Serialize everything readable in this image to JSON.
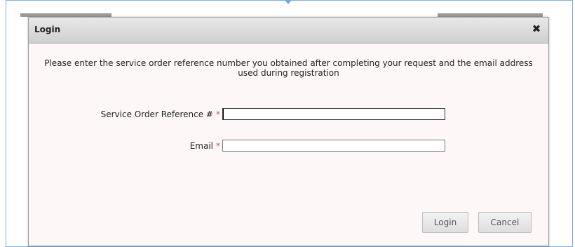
{
  "dialog": {
    "title": "Login",
    "close_glyph": "✖",
    "instructions": "Please enter the service order reference number you obtained after completing your request and the email address used during registration"
  },
  "form": {
    "reference_label": "Service Order Reference #",
    "reference_value": "",
    "email_label": "Email",
    "email_value": "",
    "required_marker": "*"
  },
  "buttons": {
    "login": "Login",
    "cancel": "Cancel"
  },
  "colors": {
    "required": "#d9534f",
    "frame_border": "#7fb0e0",
    "dialog_background": "#fdf8f7"
  },
  "icons": {
    "close": "close-icon"
  }
}
